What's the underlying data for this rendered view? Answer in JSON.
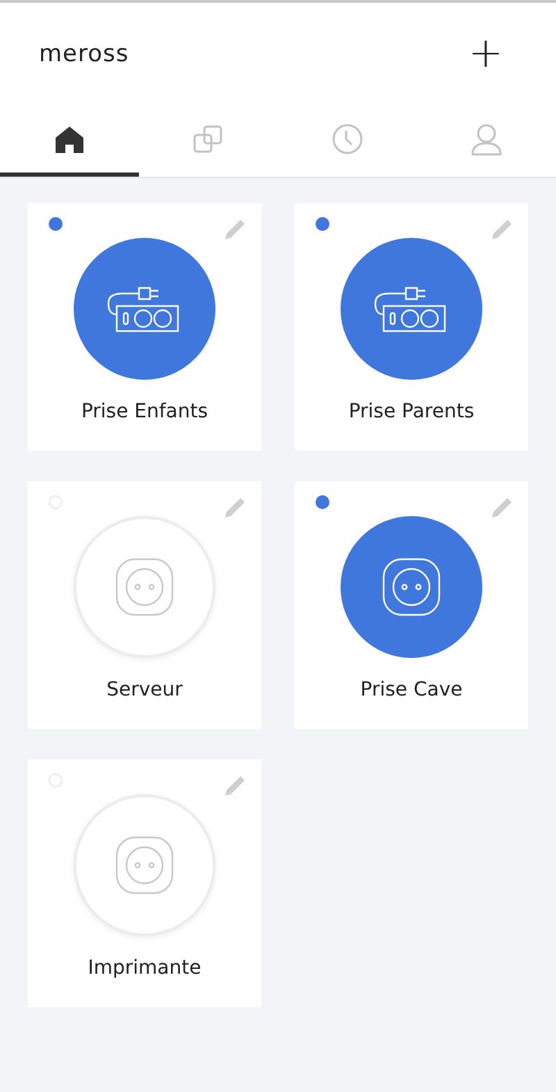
{
  "header": {
    "title": "meross",
    "add_label": "+"
  },
  "tabs": [
    {
      "kind": "home",
      "selected": true
    },
    {
      "kind": "groups",
      "selected": false
    },
    {
      "kind": "timer",
      "selected": false
    },
    {
      "kind": "account",
      "selected": false
    }
  ],
  "devices": [
    {
      "name": "Prise Enfants",
      "kind": "strip",
      "on": true
    },
    {
      "name": "Prise Parents",
      "kind": "strip",
      "on": true
    },
    {
      "name": "Serveur",
      "kind": "plug",
      "on": false
    },
    {
      "name": "Prise Cave",
      "kind": "plug",
      "on": true
    },
    {
      "name": "Imprimante",
      "kind": "plug",
      "on": false
    }
  ]
}
